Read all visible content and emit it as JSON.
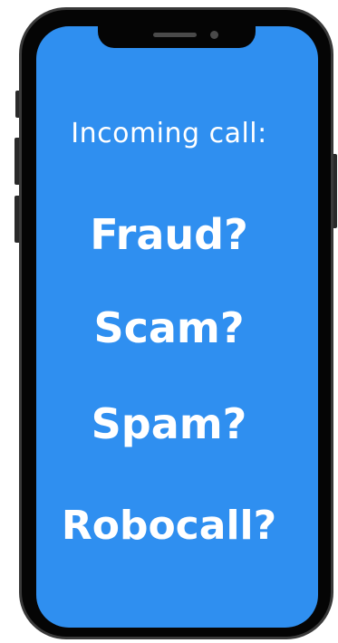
{
  "screen": {
    "header": "Incoming call:",
    "questions": [
      "Fraud?",
      "Scam?",
      "Spam?",
      "Robocall?"
    ]
  },
  "colors": {
    "screen_background": "#2f8ff0",
    "frame": "#050505",
    "text": "#ffffff"
  }
}
